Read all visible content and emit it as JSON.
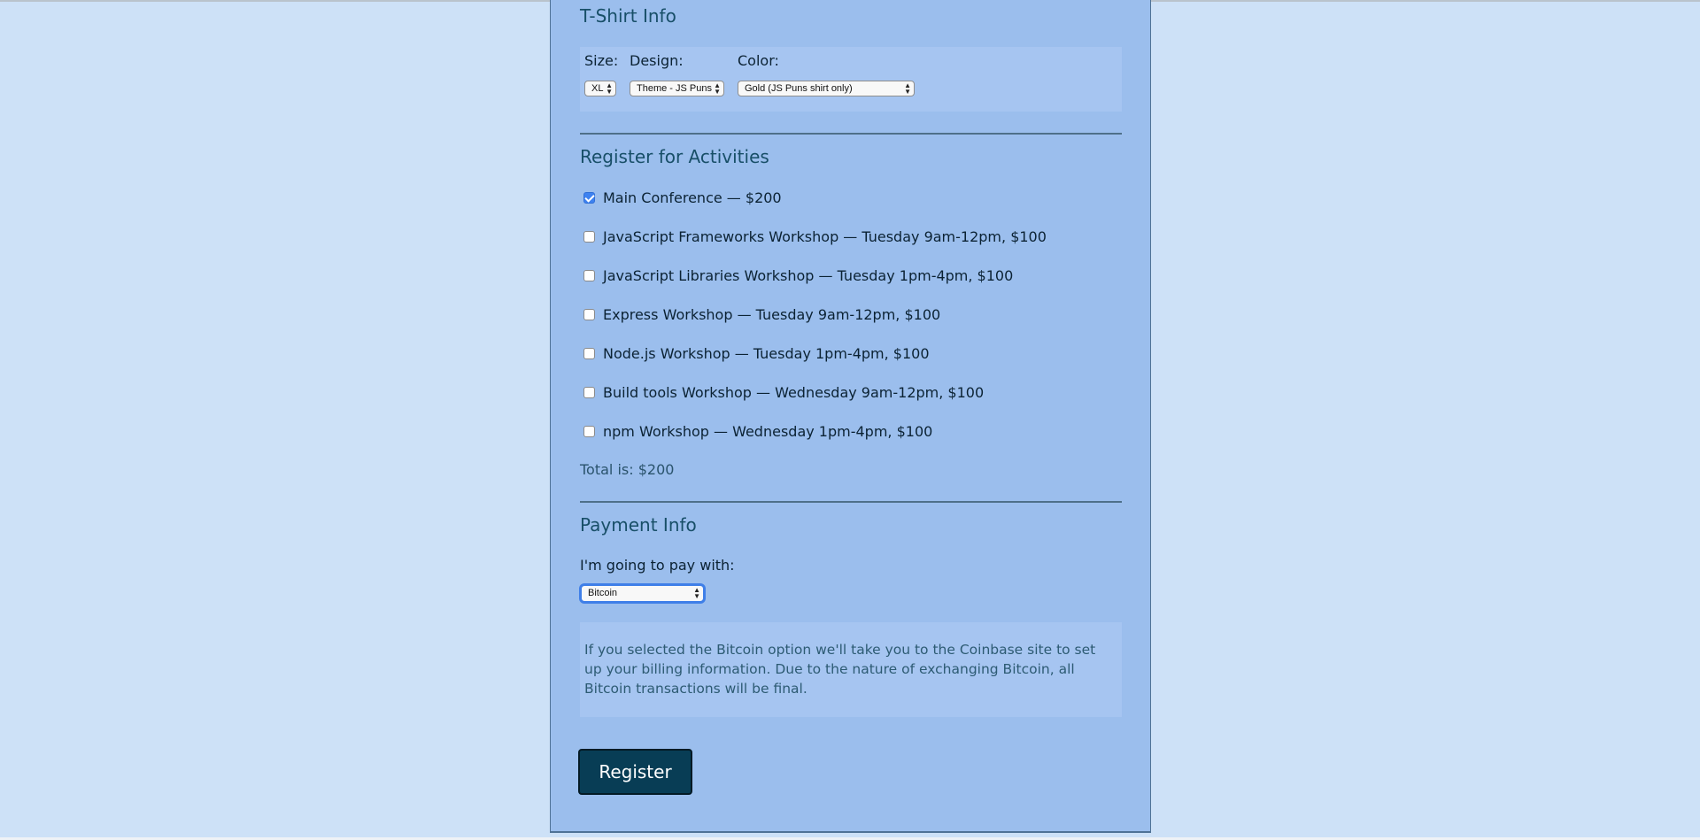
{
  "tshirt": {
    "legend": "T-Shirt Info",
    "size_label": "Size:",
    "design_label": "Design:",
    "color_label": "Color:",
    "size_value": "XL",
    "design_value": "Theme - JS Puns",
    "color_value": "Gold (JS Puns shirt only)"
  },
  "activities": {
    "legend": "Register for Activities",
    "items": [
      {
        "label": "Main Conference — $200",
        "checked": true
      },
      {
        "label": "JavaScript Frameworks Workshop — Tuesday 9am-12pm, $100",
        "checked": false
      },
      {
        "label": "JavaScript Libraries Workshop — Tuesday 1pm-4pm, $100",
        "checked": false
      },
      {
        "label": "Express Workshop — Tuesday 9am-12pm, $100",
        "checked": false
      },
      {
        "label": "Node.js Workshop — Tuesday 1pm-4pm, $100",
        "checked": false
      },
      {
        "label": "Build tools Workshop — Wednesday 9am-12pm, $100",
        "checked": false
      },
      {
        "label": "npm Workshop — Wednesday 1pm-4pm, $100",
        "checked": false
      }
    ],
    "total": "Total is: $200"
  },
  "payment": {
    "legend": "Payment Info",
    "pay_label": "I'm going to pay with:",
    "method_value": "Bitcoin",
    "bitcoin_text": "If you selected the Bitcoin option we'll take you to the Coinbase site to set up your billing information. Due to the nature of exchanging Bitcoin, all Bitcoin transactions will be final."
  },
  "register_label": "Register",
  "colors": {
    "page_background": "#cde1f7",
    "panel_background": "#9bbeed",
    "inner_box": "#a6c5f1",
    "heading_text": "#184f68",
    "button_background": "#083d55",
    "checkbox_accent": "#3e82f0"
  }
}
